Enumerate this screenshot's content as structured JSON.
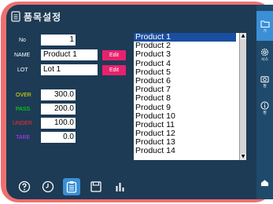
{
  "header": {
    "title": "품목설정",
    "title_icon": "document-icon"
  },
  "form": {
    "no_label": "No",
    "no_value": "1",
    "name_label": "NAME",
    "name_value": "Product 1",
    "lot_label": "LOT",
    "lot_value": "Lot 1",
    "edit_label": "Edit",
    "over_label": "OVER",
    "over_value": "300.0",
    "pass_label": "PASS",
    "pass_value": "200.0",
    "under_label": "UNDER",
    "under_value": "100.0",
    "tare_label": "TARE",
    "tare_value": "0.0"
  },
  "product_list": {
    "items": [
      "Product 1",
      "Product 2",
      "Product 3",
      "Product 4",
      "Product 5",
      "Product 6",
      "Product 7",
      "Product 8",
      "Product 9",
      "Product 10",
      "Product 11",
      "Product 12",
      "Product 13",
      "Product 14"
    ],
    "selected": "Product 1"
  },
  "toolbar": {
    "items": [
      {
        "icon": "help-icon"
      },
      {
        "icon": "clock-icon"
      },
      {
        "icon": "clipboard-icon",
        "active": true
      },
      {
        "icon": "save-icon"
      },
      {
        "icon": "bar-chart-icon"
      }
    ]
  },
  "right_nav": {
    "items": [
      {
        "icon": "folder-icon",
        "label": "기",
        "active": true
      },
      {
        "icon": "settings-icon",
        "label": "시스"
      },
      {
        "icon": "camera-icon",
        "label": "정"
      },
      {
        "icon": "info-icon",
        "label": "정"
      },
      {
        "icon": "home-icon",
        "label": ""
      }
    ]
  },
  "colors": {
    "bezel": "#ef6f6f",
    "screen_bg": "#1d3b55",
    "edit_button": "#e8216d",
    "selected_row": "#1a4ea0",
    "active_tab": "#3a8fd6",
    "over": "#e8e800",
    "pass": "#00ee00",
    "under": "#ff2a2a",
    "tare": "#b23cff"
  }
}
